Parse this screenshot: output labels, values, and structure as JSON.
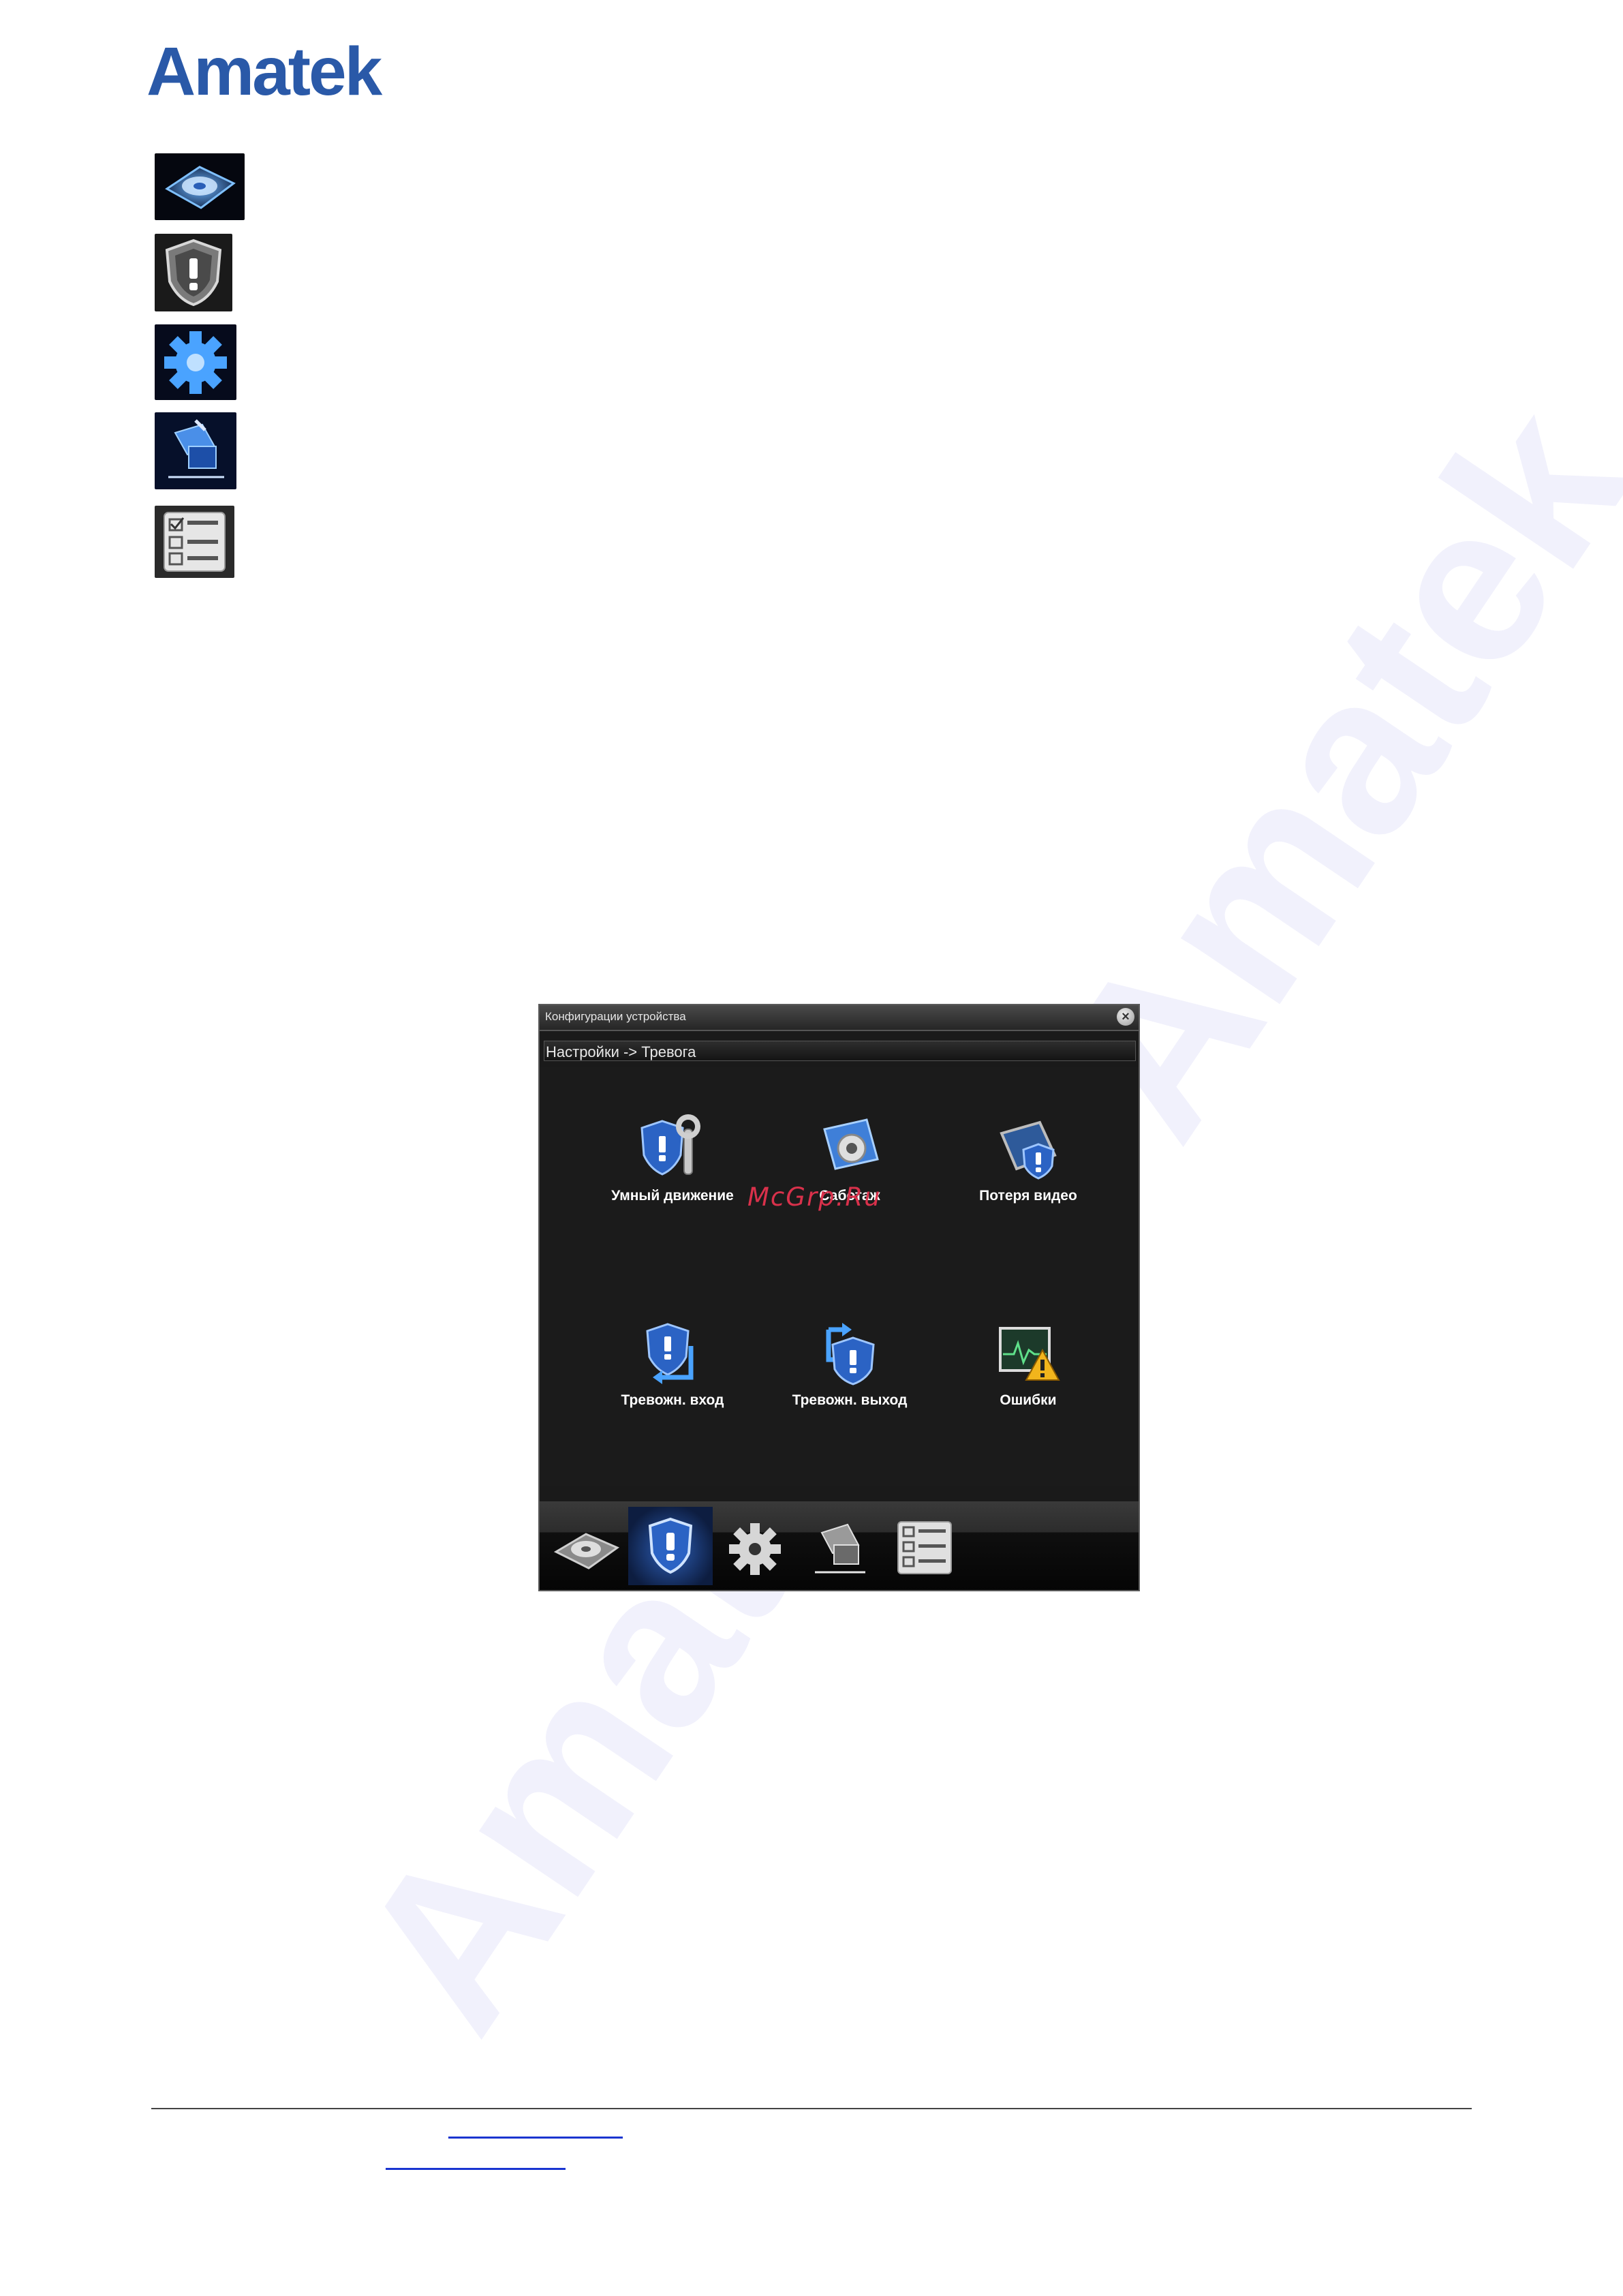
{
  "brand": {
    "logo_text": "Amatek",
    "watermark": "Amatek"
  },
  "side_icons": [
    {
      "icon": "hdd-icon"
    },
    {
      "icon": "alarm-shield-icon"
    },
    {
      "icon": "gear-icon"
    },
    {
      "icon": "system-icon"
    },
    {
      "icon": "info-list-icon"
    }
  ],
  "dvr": {
    "title": "Конфигурации устройства",
    "breadcrumb": "Настройки -> Тревога",
    "items": [
      {
        "label": "Умный движение",
        "icon": "motion-detect-icon"
      },
      {
        "label": "Саботаж",
        "icon": "video-blind-icon"
      },
      {
        "label": "Потеря видео",
        "icon": "video-loss-icon"
      },
      {
        "label": "Тревожн. вход",
        "icon": "alarm-input-icon"
      },
      {
        "label": "Тревожн. выход",
        "icon": "alarm-output-icon"
      },
      {
        "label": "Ошибки",
        "icon": "abnormality-icon"
      }
    ],
    "overlay_watermark": "McGrp.Ru",
    "bottom_tabs": [
      {
        "icon": "record-hdd-icon"
      },
      {
        "icon": "alarm-shield-icon",
        "active": true
      },
      {
        "icon": "gear-icon"
      },
      {
        "icon": "system-icon"
      },
      {
        "icon": "info-list-icon"
      }
    ]
  },
  "colors": {
    "brand": "#2a59a8",
    "link": "#1a35d0",
    "dvr_bg": "#1b1b1b"
  }
}
